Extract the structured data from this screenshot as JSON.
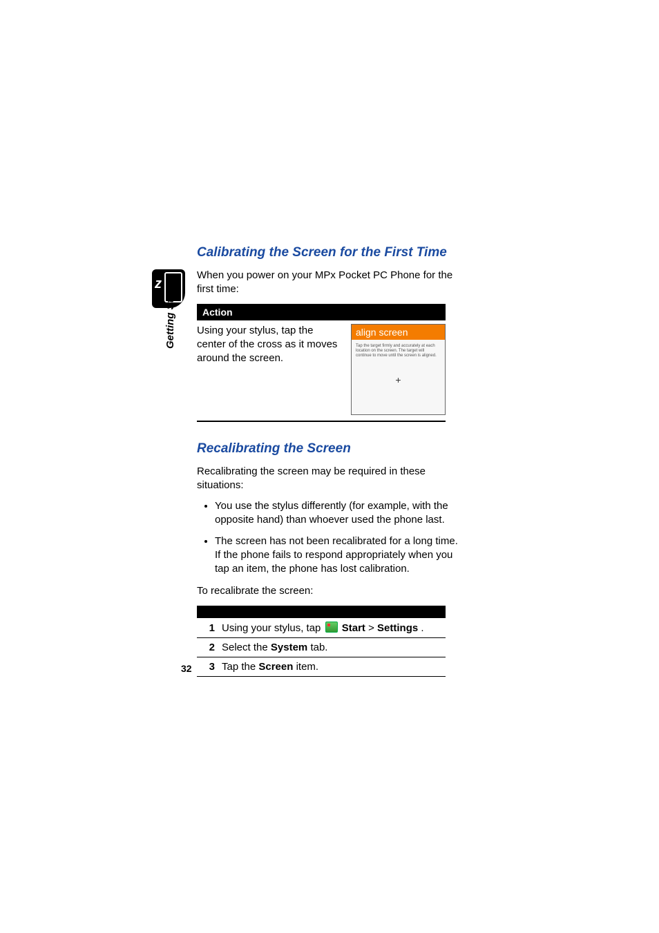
{
  "sidebar_label": "Getting Started",
  "heading1": "Calibrating the Screen for the First Time",
  "intro1": "When you power on your MPx Pocket PC Phone for the first time:",
  "action_header": "Action",
  "action_text": "Using your stylus, tap the center of the cross as it moves around the screen.",
  "align": {
    "title": "align screen",
    "instruction": "Tap the target firmly and accurately at each location on the screen. The target will continue to move until the screen is aligned."
  },
  "heading2": "Recalibrating the Screen",
  "intro2": "Recalibrating the screen may be required in these situations:",
  "bullets": [
    "You use the stylus differently (for example, with the opposite hand) than whoever used the phone last.",
    "The screen has not been recalibrated for a long time. If the phone fails to respond appropriately when you tap an item, the phone has lost calibration."
  ],
  "recal_lead": "To recalibrate the screen:",
  "steps": [
    {
      "n": "1",
      "pre": "Using your stylus, tap ",
      "b1": "Start",
      "mid": " > ",
      "b2": "Settings",
      "tail": "."
    },
    {
      "n": "2",
      "pre": "Select the ",
      "b1": "System",
      "mid": " tab.",
      "b2": "",
      "tail": ""
    },
    {
      "n": "3",
      "pre": "Tap the ",
      "b1": "Screen",
      "mid": " item.",
      "b2": "",
      "tail": ""
    }
  ],
  "page_number": "32"
}
